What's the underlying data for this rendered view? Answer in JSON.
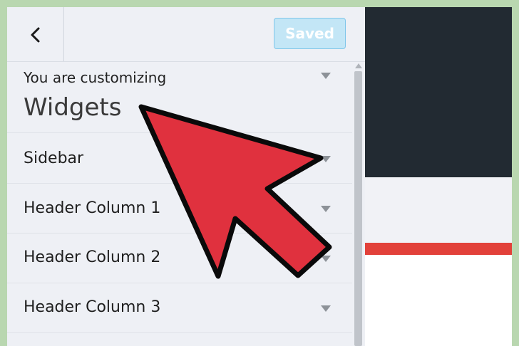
{
  "header": {
    "back_icon": "chevron-left-icon",
    "save_label": "Saved"
  },
  "intro": {
    "subtitle": "You are customizing",
    "title": "Widgets"
  },
  "sections": [
    {
      "label": "Sidebar"
    },
    {
      "label": "Header Column 1"
    },
    {
      "label": "Header Column 2"
    },
    {
      "label": "Header Column 3"
    }
  ],
  "colors": {
    "pointer": "#e0313e",
    "accent_border": "#7fc6ea",
    "preview_dark": "#222a32",
    "preview_red": "#e2413a"
  }
}
